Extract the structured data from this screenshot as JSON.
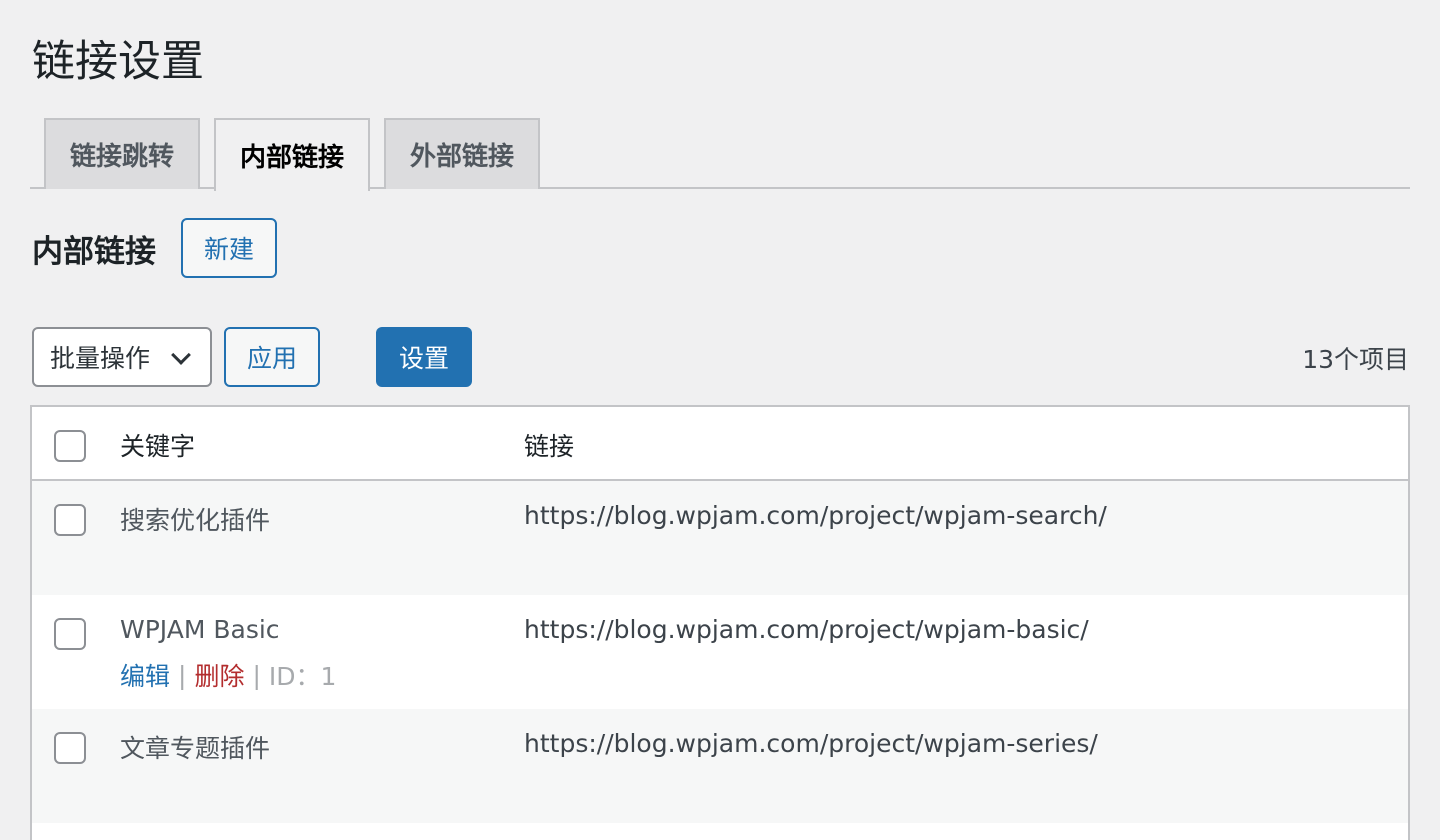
{
  "page": {
    "title": "链接设置"
  },
  "tabs": [
    {
      "label": "链接跳转",
      "active": false
    },
    {
      "label": "内部链接",
      "active": true
    },
    {
      "label": "外部链接",
      "active": false
    }
  ],
  "section": {
    "heading": "内部链接",
    "add_new_label": "新建"
  },
  "toolbar": {
    "bulk_action": "批量操作",
    "apply_label": "应用",
    "settings_label": "设置",
    "item_count": "13个项目"
  },
  "table": {
    "headers": {
      "keyword": "关键字",
      "link": "链接"
    },
    "rows": [
      {
        "keyword": "搜索优化插件",
        "link": "https://blog.wpjam.com/project/wpjam-search/"
      },
      {
        "keyword": "WPJAM Basic",
        "link": "https://blog.wpjam.com/project/wpjam-basic/",
        "actions": {
          "edit": "编辑",
          "sep": "|",
          "delete": "删除",
          "id": "ID：1"
        }
      },
      {
        "keyword": "文章专题插件",
        "link": "https://blog.wpjam.com/project/wpjam-series/"
      }
    ]
  },
  "colors": {
    "primary": "#2271b1",
    "danger": "#b32d2e",
    "background": "#f0f0f1"
  }
}
